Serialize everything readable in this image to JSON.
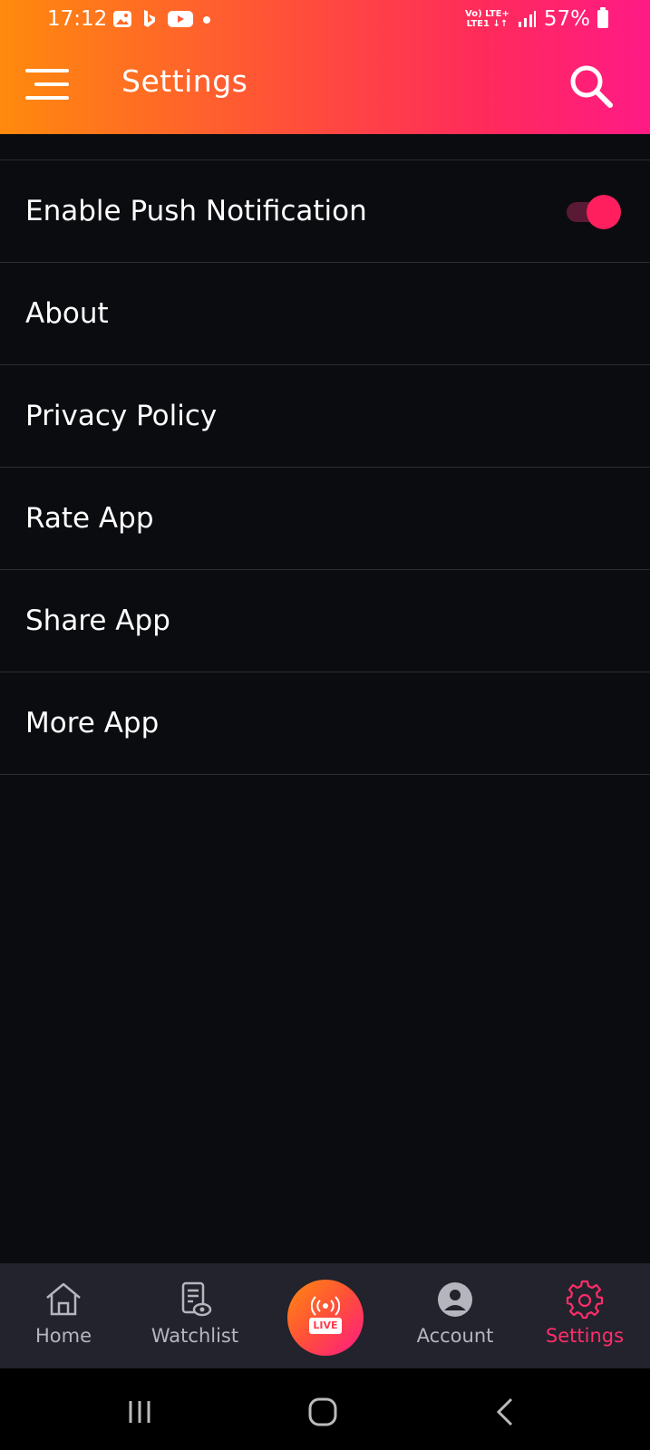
{
  "status_bar": {
    "time": "17:12",
    "network_top": "Vo) LTE+",
    "network_bottom": "LTE1 ↓↑",
    "battery": "57%"
  },
  "header": {
    "title": "Settings",
    "menu_icon": "hamburger-menu-icon",
    "search_icon": "search-icon",
    "gradient": [
      "#ff8a0d",
      "#ff1a86"
    ]
  },
  "settings": {
    "items": [
      {
        "label": "Enable Push Notification",
        "toggle": true
      },
      {
        "label": "About"
      },
      {
        "label": "Privacy Policy"
      },
      {
        "label": "Rate App"
      },
      {
        "label": "Share App"
      },
      {
        "label": "More App"
      }
    ]
  },
  "bottom_nav": {
    "items": [
      {
        "label": "Home",
        "icon": "home-icon"
      },
      {
        "label": "Watchlist",
        "icon": "watchlist-icon"
      },
      {
        "label": "LIVE",
        "icon": "live-broadcast-icon"
      },
      {
        "label": "Account",
        "icon": "account-icon"
      },
      {
        "label": "Settings",
        "icon": "gear-icon",
        "active": true
      }
    ],
    "active_color": "#ff2d6a"
  }
}
